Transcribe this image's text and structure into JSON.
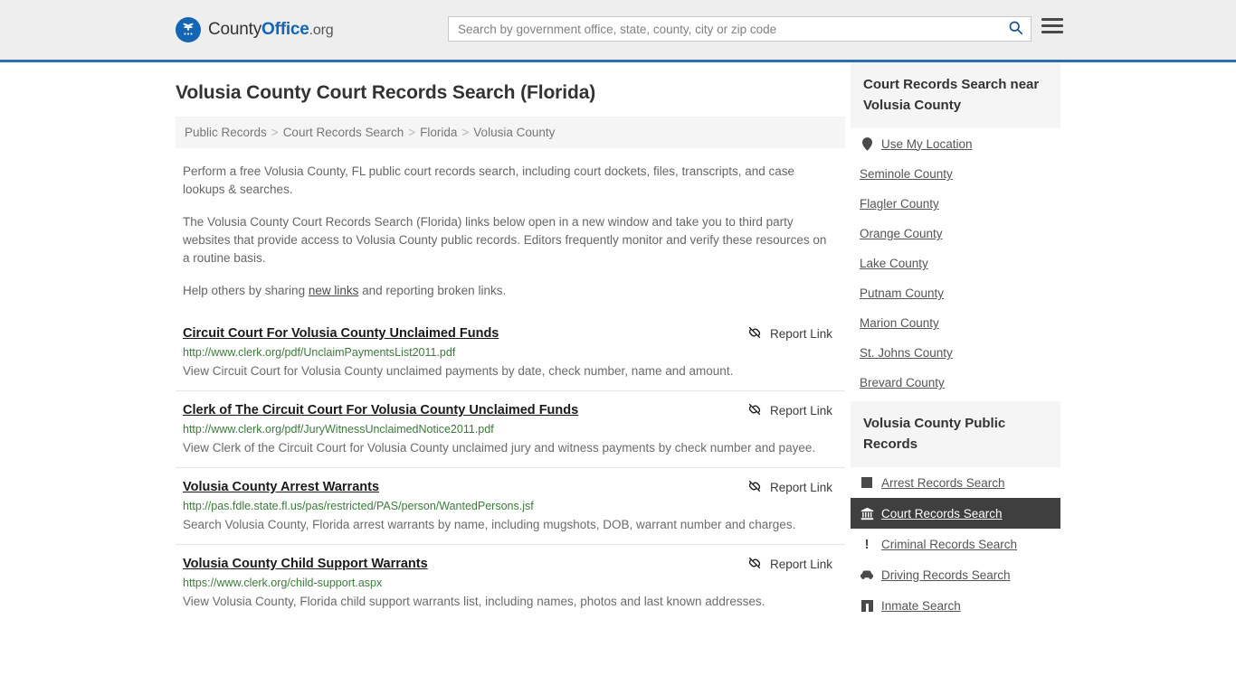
{
  "header": {
    "brand_pre": "County",
    "brand_mid": "Office",
    "brand_tld": ".org",
    "logo_icon": "eagle-seal-icon",
    "search_placeholder": "Search by government office, state, county, city or zip code",
    "search_value": "",
    "search_icon": "search-icon",
    "menu_icon": "hamburger-menu-icon",
    "accent_color": "#2c6faf"
  },
  "main": {
    "title": "Volusia County Court Records Search (Florida)",
    "breadcrumb": {
      "separator": ">",
      "items": [
        {
          "label": "Public Records"
        },
        {
          "label": "Court Records Search"
        },
        {
          "label": "Florida"
        },
        {
          "label": "Volusia County"
        }
      ]
    },
    "intro": {
      "p1": "Perform a free Volusia County, FL public court records search, including court dockets, files, transcripts, and case lookups & searches.",
      "p2": "The Volusia County Court Records Search (Florida) links below open in a new window and take you to third party websites that provide access to Volusia County public records. Editors frequently monitor and verify these resources on a routine basis.",
      "p3_before": "Help others by sharing ",
      "p3_link": "new links",
      "p3_after": " and reporting broken links."
    },
    "report_link_label": "Report Link",
    "report_link_icon": "broken-link-icon",
    "results": [
      {
        "title": "Circuit Court For Volusia County Unclaimed Funds",
        "url": "http://www.clerk.org/pdf/UnclaimPaymentsList2011.pdf",
        "description": "View Circuit Court for Volusia County unclaimed payments by date, check number, name and amount."
      },
      {
        "title": "Clerk of The Circuit Court For Volusia County Unclaimed Funds",
        "url": "http://www.clerk.org/pdf/JuryWitnessUnclaimedNotice2011.pdf",
        "description": "View Clerk of the Circuit Court for Volusia County unclaimed jury and witness payments by check number and payee."
      },
      {
        "title": "Volusia County Arrest Warrants",
        "url": "http://pas.fdle.state.fl.us/pas/restricted/PAS/person/WantedPersons.jsf",
        "description": "Search Volusia County, Florida arrest warrants by name, including mugshots, DOB, warrant number and charges."
      },
      {
        "title": "Volusia County Child Support Warrants",
        "url": "https://www.clerk.org/child-support.aspx",
        "description": "View Volusia County, Florida child support warrants list, including names, photos and last known addresses."
      }
    ]
  },
  "sidebar": {
    "nearby": {
      "heading": "Court Records Search near Volusia County",
      "items": [
        {
          "label": "Use My Location",
          "icon": "map-pin-icon"
        },
        {
          "label": "Seminole County",
          "icon": ""
        },
        {
          "label": "Flagler County",
          "icon": ""
        },
        {
          "label": "Orange County",
          "icon": ""
        },
        {
          "label": "Lake County",
          "icon": ""
        },
        {
          "label": "Putnam County",
          "icon": ""
        },
        {
          "label": "Marion County",
          "icon": ""
        },
        {
          "label": "St. Johns County",
          "icon": ""
        },
        {
          "label": "Brevard County",
          "icon": ""
        }
      ]
    },
    "public_records": {
      "heading": "Volusia County Public Records",
      "items": [
        {
          "label": "Arrest Records Search",
          "icon": "square-icon",
          "active": false
        },
        {
          "label": "Court Records Search",
          "icon": "courthouse-icon",
          "active": true
        },
        {
          "label": "Criminal Records Search",
          "icon": "exclamation-icon",
          "active": false
        },
        {
          "label": "Driving Records Search",
          "icon": "car-icon",
          "active": false
        },
        {
          "label": "Inmate Search",
          "icon": "jail-icon",
          "active": false
        }
      ]
    }
  }
}
